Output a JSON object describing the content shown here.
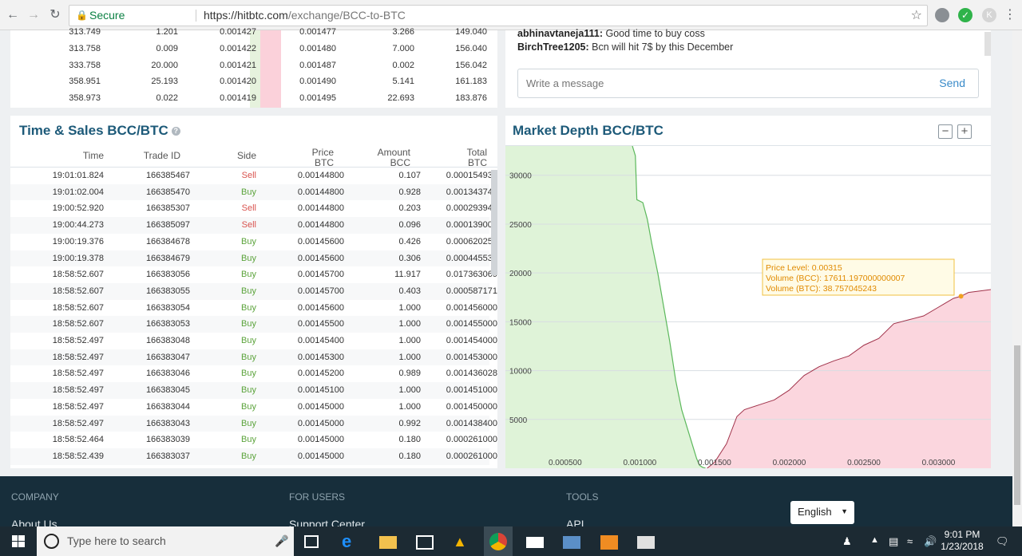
{
  "browser": {
    "secure_label": "Secure",
    "url_host": "https://hitbtc.com",
    "url_path": "/exchange/BCC-to-BTC"
  },
  "orderbook": {
    "rows": [
      {
        "a": "313.749",
        "b": "1.201",
        "c": "0.001427",
        "d": "0.001477",
        "e": "3.266",
        "f": "149.040"
      },
      {
        "a": "313.758",
        "b": "0.009",
        "c": "0.001422",
        "d": "0.001480",
        "e": "7.000",
        "f": "156.040"
      },
      {
        "a": "333.758",
        "b": "20.000",
        "c": "0.001421",
        "d": "0.001487",
        "e": "0.002",
        "f": "156.042"
      },
      {
        "a": "358.951",
        "b": "25.193",
        "c": "0.001420",
        "d": "0.001490",
        "e": "5.141",
        "f": "161.183"
      },
      {
        "a": "358.973",
        "b": "0.022",
        "c": "0.001419",
        "d": "0.001495",
        "e": "22.693",
        "f": "183.876"
      }
    ]
  },
  "chat": {
    "messages": [
      {
        "user": "abhinavtaneja111:",
        "text": "Good time to buy coss"
      },
      {
        "user": "BirchTree1205:",
        "text": "Bcn will hit 7$ by this December"
      }
    ],
    "placeholder": "Write a message",
    "send_label": "Send"
  },
  "sales": {
    "title": "Time & Sales BCC/BTC",
    "headers": {
      "time": "Time",
      "trade_id": "Trade ID",
      "side": "Side",
      "price": "Price",
      "price_unit": "BTC",
      "amount": "Amount",
      "amount_unit": "BCC",
      "total": "Total",
      "total_unit": "BTC"
    },
    "rows": [
      {
        "time": "19:01:01.824",
        "id": "166385467",
        "side": "Sell",
        "price": "0.00144800",
        "amount": "0.107",
        "total": "0.000154936"
      },
      {
        "time": "19:01:02.004",
        "id": "166385470",
        "side": "Buy",
        "price": "0.00144800",
        "amount": "0.928",
        "total": "0.001343744"
      },
      {
        "time": "19:00:52.920",
        "id": "166385307",
        "side": "Sell",
        "price": "0.00144800",
        "amount": "0.203",
        "total": "0.000293944"
      },
      {
        "time": "19:00:44.273",
        "id": "166385097",
        "side": "Sell",
        "price": "0.00144800",
        "amount": "0.096",
        "total": "0.000139008"
      },
      {
        "time": "19:00:19.376",
        "id": "166384678",
        "side": "Buy",
        "price": "0.00145600",
        "amount": "0.426",
        "total": "0.000620256"
      },
      {
        "time": "19:00:19.378",
        "id": "166384679",
        "side": "Buy",
        "price": "0.00145600",
        "amount": "0.306",
        "total": "0.000445536"
      },
      {
        "time": "18:58:52.607",
        "id": "166383056",
        "side": "Buy",
        "price": "0.00145700",
        "amount": "11.917",
        "total": "0.017363069"
      },
      {
        "time": "18:58:52.607",
        "id": "166383055",
        "side": "Buy",
        "price": "0.00145700",
        "amount": "0.403",
        "total": "0.000587171"
      },
      {
        "time": "18:58:52.607",
        "id": "166383054",
        "side": "Buy",
        "price": "0.00145600",
        "amount": "1.000",
        "total": "0.001456000"
      },
      {
        "time": "18:58:52.607",
        "id": "166383053",
        "side": "Buy",
        "price": "0.00145500",
        "amount": "1.000",
        "total": "0.001455000"
      },
      {
        "time": "18:58:52.497",
        "id": "166383048",
        "side": "Buy",
        "price": "0.00145400",
        "amount": "1.000",
        "total": "0.001454000"
      },
      {
        "time": "18:58:52.497",
        "id": "166383047",
        "side": "Buy",
        "price": "0.00145300",
        "amount": "1.000",
        "total": "0.001453000"
      },
      {
        "time": "18:58:52.497",
        "id": "166383046",
        "side": "Buy",
        "price": "0.00145200",
        "amount": "0.989",
        "total": "0.001436028"
      },
      {
        "time": "18:58:52.497",
        "id": "166383045",
        "side": "Buy",
        "price": "0.00145100",
        "amount": "1.000",
        "total": "0.001451000"
      },
      {
        "time": "18:58:52.497",
        "id": "166383044",
        "side": "Buy",
        "price": "0.00145000",
        "amount": "1.000",
        "total": "0.001450000"
      },
      {
        "time": "18:58:52.497",
        "id": "166383043",
        "side": "Buy",
        "price": "0.00145000",
        "amount": "0.992",
        "total": "0.001438400"
      },
      {
        "time": "18:58:52.464",
        "id": "166383039",
        "side": "Buy",
        "price": "0.00145000",
        "amount": "0.180",
        "total": "0.000261000"
      },
      {
        "time": "18:58:52.439",
        "id": "166383037",
        "side": "Buy",
        "price": "0.00145000",
        "amount": "0.180",
        "total": "0.000261000"
      }
    ]
  },
  "depth": {
    "title": "Market Depth BCC/BTC",
    "zoom_out": "−",
    "zoom_in": "+",
    "tooltip": {
      "line1": "Price Level: 0.00315",
      "line2": "Volume (BCC): 17611.197000000007",
      "line3": "Volume (BTC): 38.757045243"
    }
  },
  "chart_data": {
    "type": "area",
    "title": "Market Depth BCC/BTC",
    "xlabel": "",
    "ylabel": "",
    "xlim": [
      0.0001,
      0.00335
    ],
    "ylim": [
      0,
      33000
    ],
    "x_ticks": [
      "0.000500",
      "0.001000",
      "0.001500",
      "0.002000",
      "0.002500",
      "0.003000"
    ],
    "y_ticks": [
      "5000",
      "10000",
      "15000",
      "20000",
      "25000",
      "30000"
    ],
    "bid_color": "#dff3d8",
    "bid_line_color": "#5cb85c",
    "ask_color": "#fbd6de",
    "ask_line_color": "#a0324a",
    "series": [
      {
        "side": "bid",
        "x": [
          0.00095,
          0.00097,
          0.00098,
          0.00102,
          0.00105,
          0.00108,
          0.00112,
          0.00116,
          0.0012,
          0.00124,
          0.00128,
          0.00132,
          0.00136,
          0.00138,
          0.0014,
          0.00142,
          0.00144
        ],
        "y": [
          33000,
          32000,
          27500,
          27200,
          25500,
          23000,
          20000,
          16500,
          13000,
          9000,
          6000,
          4000,
          2000,
          1000,
          300,
          100,
          0
        ]
      },
      {
        "side": "ask",
        "x": [
          0.00145,
          0.0015,
          0.00158,
          0.00165,
          0.0017,
          0.0018,
          0.0019,
          0.002,
          0.0021,
          0.0022,
          0.0023,
          0.0024,
          0.0025,
          0.0026,
          0.0027,
          0.0028,
          0.0029,
          0.003,
          0.0031,
          0.00315,
          0.0032,
          0.00335
        ],
        "y": [
          0,
          600,
          2500,
          5300,
          6000,
          6500,
          7000,
          8000,
          9500,
          10400,
          11000,
          11500,
          12600,
          13300,
          14800,
          15200,
          15600,
          16500,
          17400,
          17611,
          18000,
          18300
        ]
      }
    ]
  },
  "footer": {
    "col1_title": "COMPANY",
    "col1_link": "About Us",
    "col2_title": "FOR USERS",
    "col2_link": "Support Center",
    "col3_title": "TOOLS",
    "col3_link": "API",
    "language": "English"
  },
  "taskbar": {
    "search_placeholder": "Type here to search",
    "time": "9:01 PM",
    "date": "1/23/2018"
  }
}
